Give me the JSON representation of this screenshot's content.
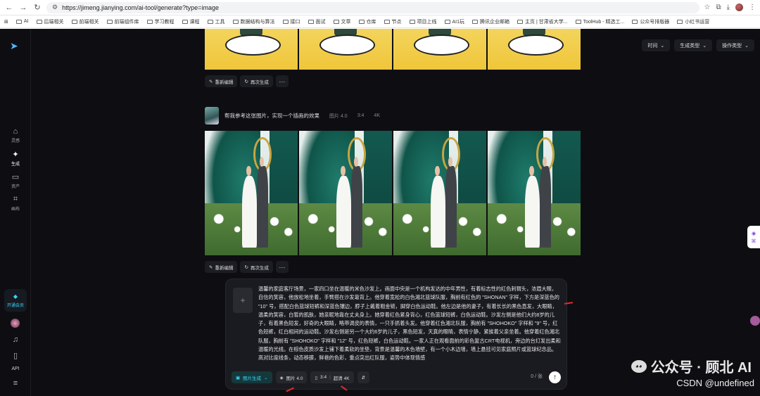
{
  "browser": {
    "url": "https://jimeng.jianying.com/ai-tool/generate?type=image",
    "bookmarks": [
      "AI",
      "后端相关",
      "前端相关",
      "前端组件库",
      "学习教程",
      "课程",
      "工具",
      "数据结构与算法",
      "接口",
      "面试",
      "文章",
      "仓库",
      "节点",
      "项目上线",
      "AI1玩",
      "腾讯企业邮箱",
      "主页 | 甘肃省大学...",
      "ToolHub - 精选工...",
      "公众号排版器",
      "小红书运营"
    ]
  },
  "sidebar": {
    "items": [
      {
        "label": "灵感",
        "icon": "home-icon"
      },
      {
        "label": "生成",
        "icon": "sparkle-icon"
      },
      {
        "label": "资产",
        "icon": "folder-icon"
      },
      {
        "label": "画布",
        "icon": "canvas-icon"
      }
    ],
    "vip_label": "开通会员",
    "api_label": "API"
  },
  "filters": [
    {
      "label": "时间"
    },
    {
      "label": "生成类型"
    },
    {
      "label": "操作类型"
    }
  ],
  "actions": {
    "reedit": "重新编辑",
    "regenerate": "再次生成",
    "more": "···"
  },
  "task": {
    "prompt": "帮我参考这张图片，实现一个插画的效果",
    "model": "图片 4.0",
    "ratio": "3:4",
    "resolution": "4K"
  },
  "composer": {
    "prompt_text": "温馨的家庭客厅场景，一家四口坐在温暖的米色沙发上。画面中央是一个机构发达的中年男性，有着标志性的红色刺猬头，浓眉大眼，自信的笑容，他放松地坐着，手臂搭在沙发靠背上。他穿着宽松的白色湘北篮球队服，胸前有红色的 \"SHONAN\" 字样，下方是深蓝色的 \"10\" 号，搭配白色篮球短裤和深蓝色镶边，脖子上戴着粗金链，脚穿白色运动鞋。他左边是他的妻子，有着长长的黑色直发，大眼睛，温柔的笑容，白皙的肌肤，她亲昵地靠在丈夫身上。她穿着红色紧身背心，红色篮球短裤，白色运动鞋。沙发左侧是他们大约8岁的儿子，有着黑色短发，好奇的大眼睛，略带调皮的表情，一只手抓着头发。他穿着红色湘北队服，胸前有 \"SHOHOKO\" 字样和 \"9\" 号，红色短裤，红白相间的运动鞋。沙发右侧是另一个大约6岁的儿子，黑色短发，天真的眼睛，表情宁静，紧挨着父亲坐着。他穿着红色湘北队服，胸前有 \"SHOHOKO\" 字样和 \"12\" 号，红色短裤，白色运动鞋。一家人正在观看面前的彩色复古CRT电视机，旁边的台灯发出柔和温暖的光线。在棕色皮质沙发上铺下着柔软的坐垫，背景是温馨的木色墙壁，有一个小木边墙，墙上悬挂可见家庭照片或篮球纪念品。高对比度线条，动态移膜，鲜艳的色彩，重点突出红队服，姿势中体现情感",
    "mode": "图片生成",
    "model": "图片 4.0",
    "ratio": "3:4",
    "resolution": "超清 4K",
    "counter": "0 / 张"
  },
  "watermark": {
    "line1": "公众号 · 顾北 AI",
    "line2": "CSDN @undefined"
  },
  "colors": {
    "background": "#0e0e12",
    "accent": "#39d5ff",
    "panel": "#1a1b20"
  }
}
